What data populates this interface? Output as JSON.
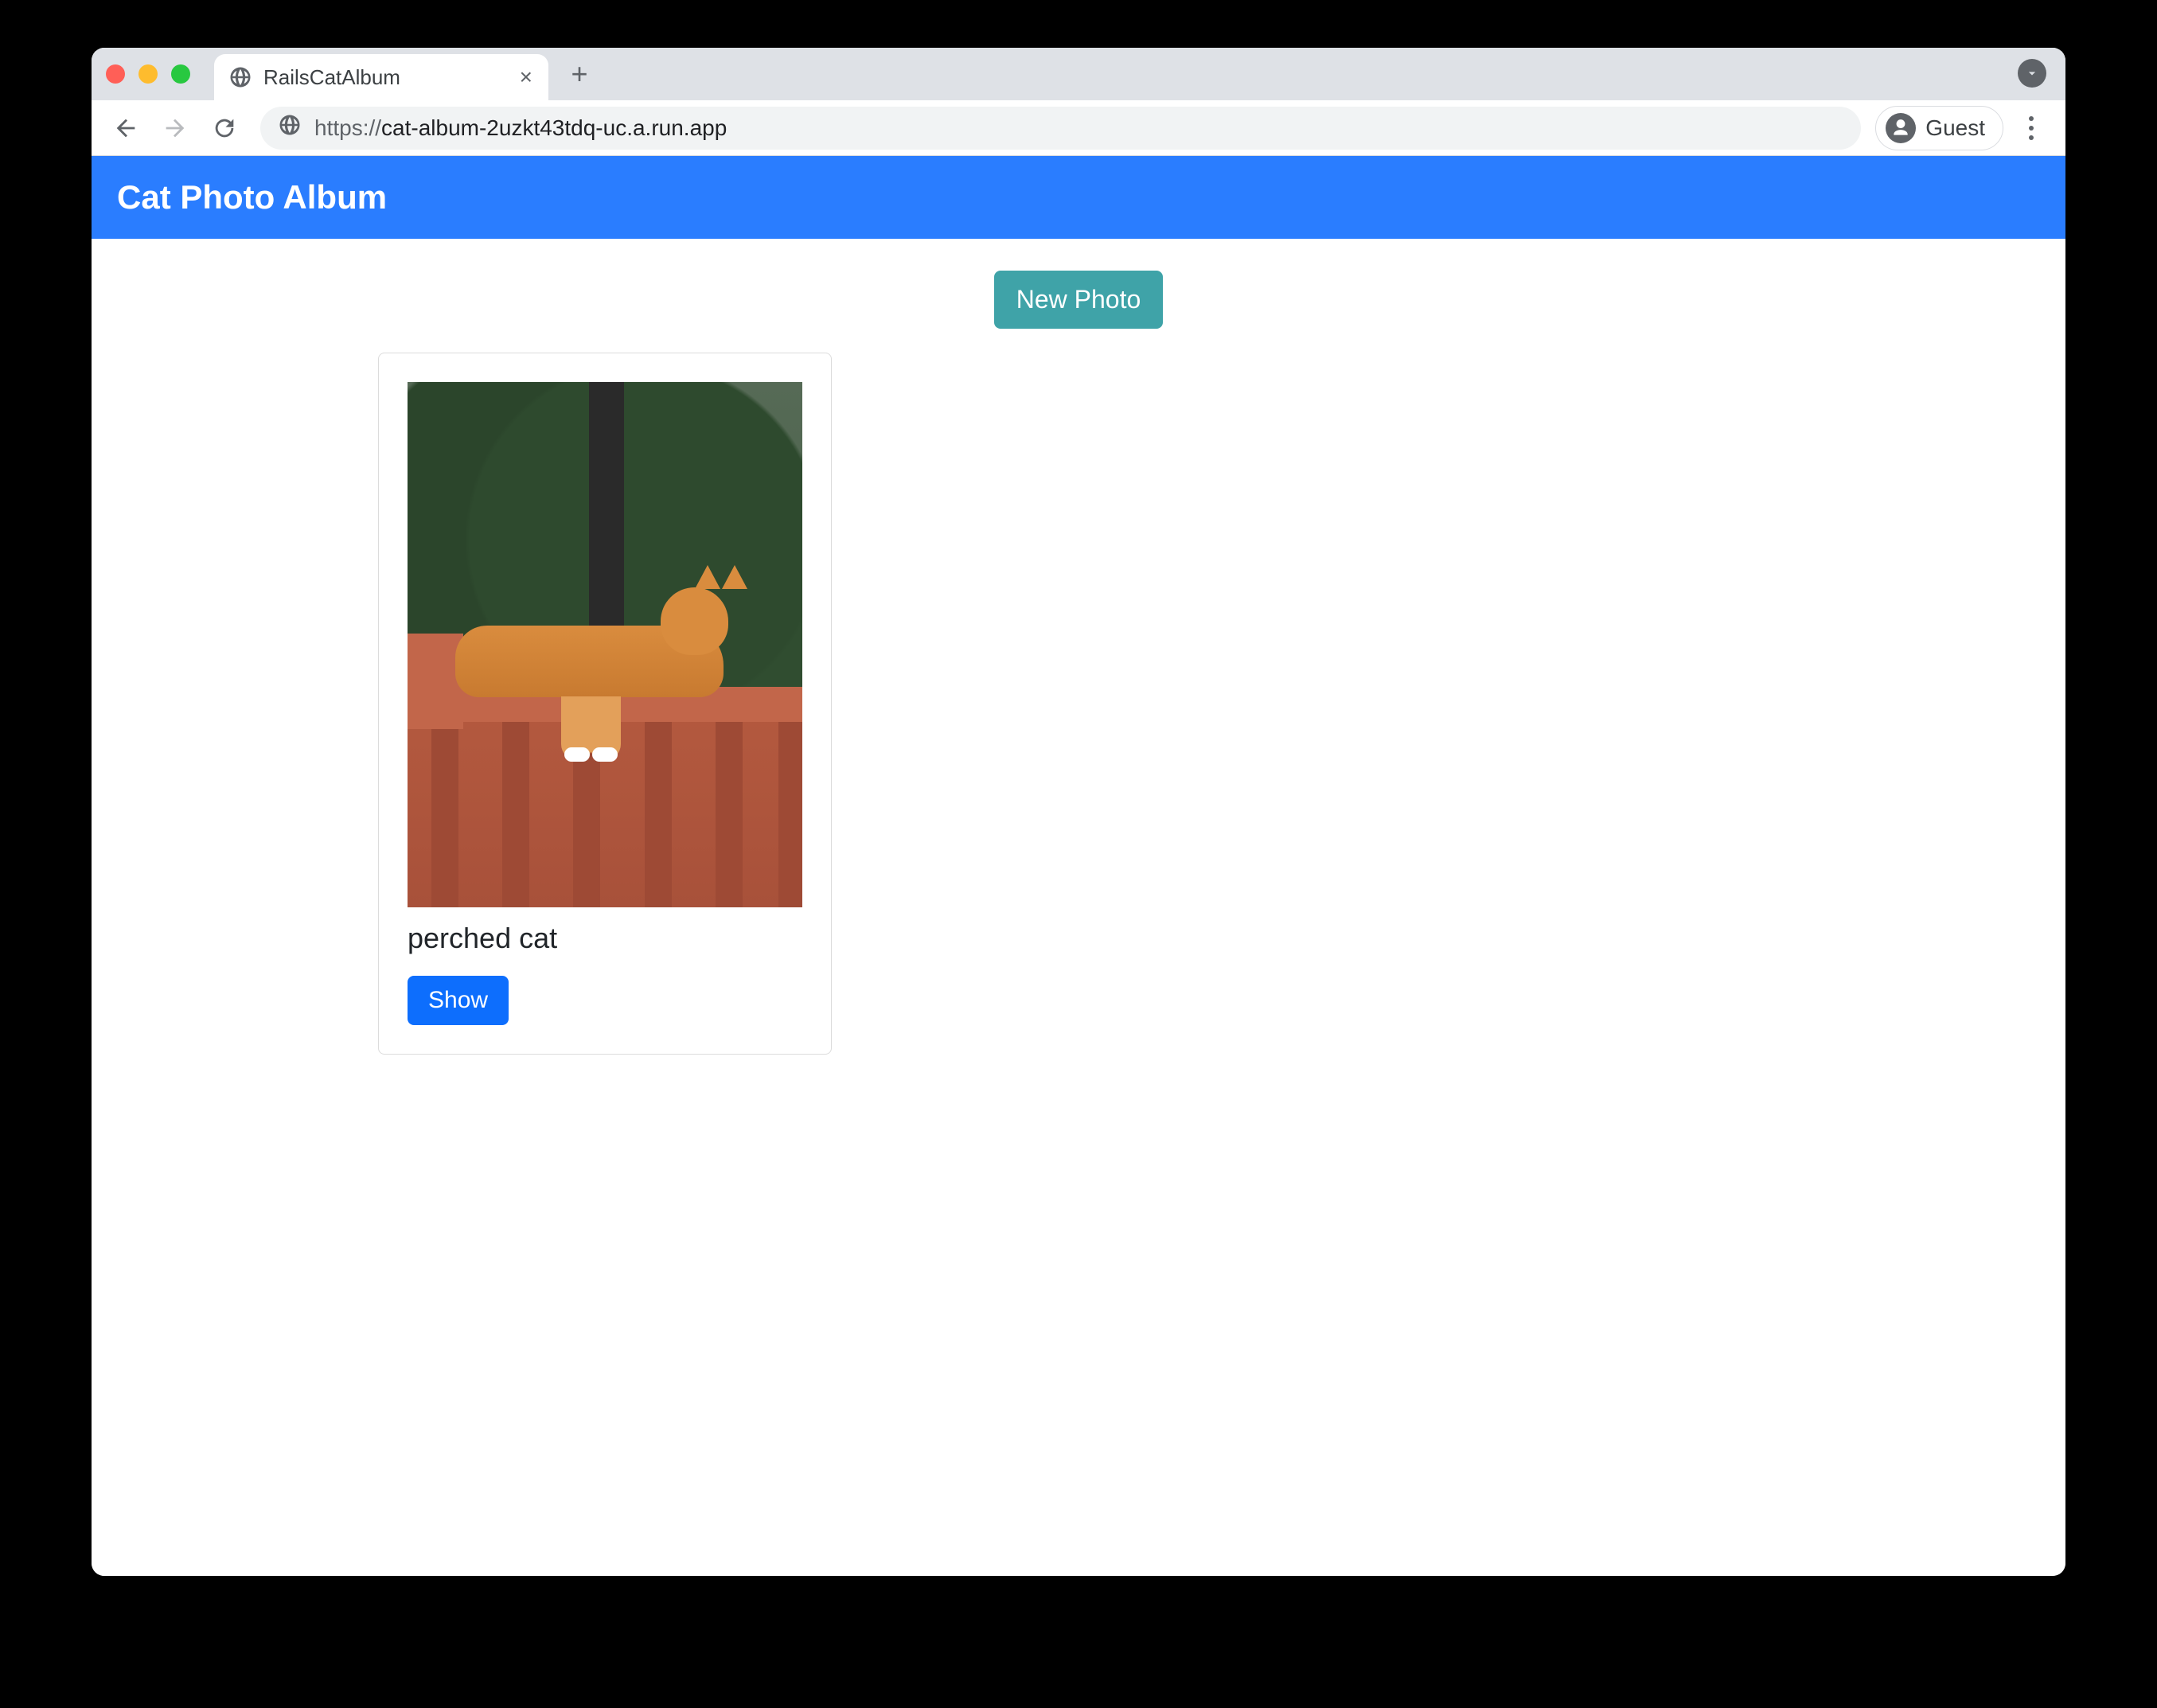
{
  "browser": {
    "tab": {
      "title": "RailsCatAlbum"
    },
    "address": {
      "protocol": "https://",
      "host_path": "cat-album-2uzkt43tdq-uc.a.run.app"
    },
    "profile_label": "Guest"
  },
  "app": {
    "header_title": "Cat Photo Album",
    "new_photo_label": "New Photo"
  },
  "photos": [
    {
      "caption": "perched cat",
      "show_label": "Show"
    }
  ]
}
